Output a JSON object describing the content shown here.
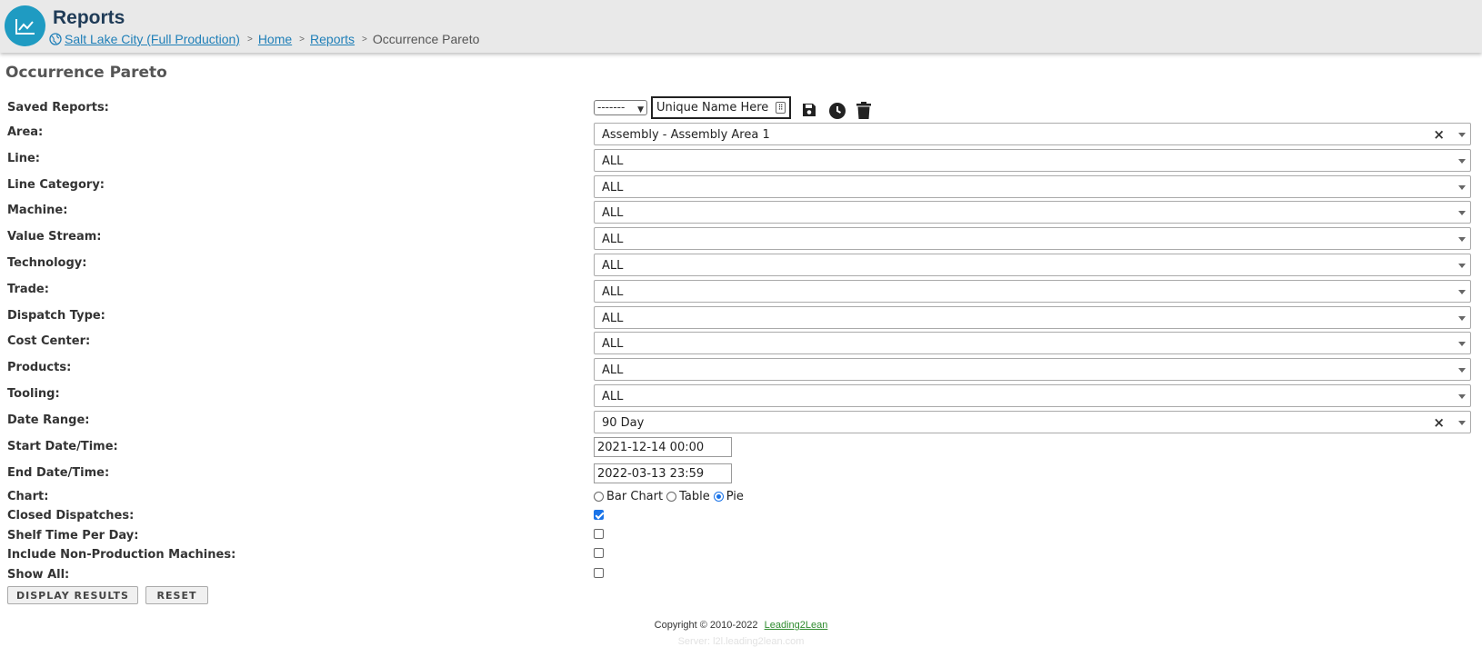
{
  "header": {
    "title": "Reports",
    "breadcrumbs": {
      "site": "Salt Lake City (Full Production)",
      "home": "Home",
      "reports": "Reports",
      "current": "Occurrence Pareto"
    }
  },
  "page_title": "Occurrence Pareto",
  "saved_reports": {
    "label": "Saved Reports:",
    "selected": "-------",
    "name_placeholder": "Unique Name Here"
  },
  "filters": [
    {
      "label": "Area:",
      "value": "Assembly - Assembly Area 1",
      "clearable": true
    },
    {
      "label": "Line:",
      "value": "ALL"
    },
    {
      "label": "Line Category:",
      "value": "ALL"
    },
    {
      "label": "Machine:",
      "value": "ALL"
    },
    {
      "label": "Value Stream:",
      "value": "ALL"
    },
    {
      "label": "Technology:",
      "value": "ALL"
    },
    {
      "label": "Trade:",
      "value": "ALL"
    },
    {
      "label": "Dispatch Type:",
      "value": "ALL"
    },
    {
      "label": "Cost Center:",
      "value": "ALL"
    },
    {
      "label": "Products:",
      "value": "ALL"
    },
    {
      "label": "Tooling:",
      "value": "ALL"
    },
    {
      "label": "Date Range:",
      "value": "90 Day",
      "clearable": true
    }
  ],
  "start_date": {
    "label": "Start Date/Time:",
    "value": "2021-12-14 00:00"
  },
  "end_date": {
    "label": "End Date/Time:",
    "value": "2022-03-13 23:59"
  },
  "chart": {
    "label": "Chart:",
    "options": [
      "Bar Chart",
      "Table",
      "Pie"
    ],
    "selected": "Pie"
  },
  "checkboxes": [
    {
      "label": "Closed Dispatches:",
      "checked": true
    },
    {
      "label": "Shelf Time Per Day:",
      "checked": false
    },
    {
      "label": "Include Non-Production Machines:",
      "checked": false
    },
    {
      "label": "Show All:",
      "checked": false
    }
  ],
  "buttons": {
    "display": "DISPLAY RESULTS",
    "reset": "RESET"
  },
  "footer": {
    "copyright": "Copyright © 2010-2022",
    "link": "Leading2Lean",
    "server": "Server: l2l.leading2lean.com"
  },
  "icons": {
    "logo": "line-chart-icon",
    "globe": "globe-icon",
    "save": "save-icon",
    "history": "clock-icon",
    "delete": "trash-icon",
    "clear": "clear-icon"
  },
  "colors": {
    "accent": "#1f9bc2",
    "link": "#1f7fb8",
    "header_bg": "#e9e9e9",
    "footer_link": "#2e8b2e"
  }
}
